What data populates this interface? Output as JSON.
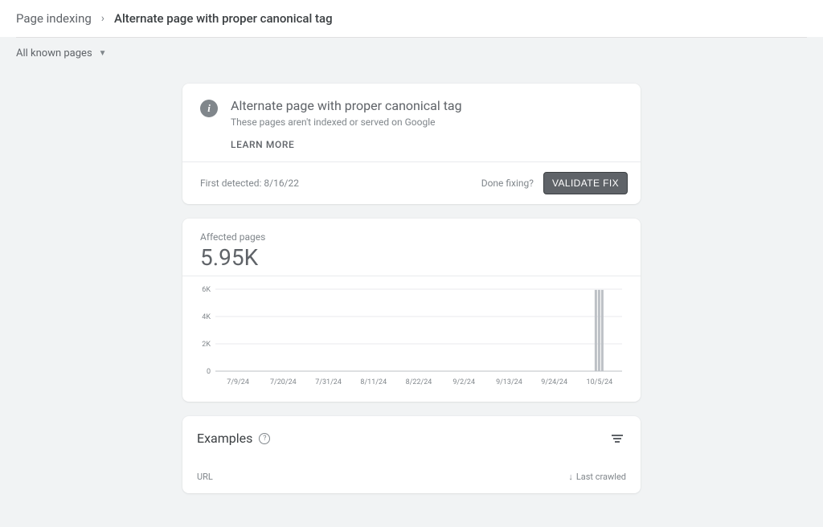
{
  "breadcrumb": {
    "parent": "Page indexing",
    "current": "Alternate page with proper canonical tag"
  },
  "filter": {
    "label": "All known pages"
  },
  "issue": {
    "title": "Alternate page with proper canonical tag",
    "subtitle": "These pages aren't indexed or served on Google",
    "learn_more": "LEARN MORE"
  },
  "validation": {
    "first_detected_label": "First detected:",
    "first_detected_date": "8/16/22",
    "done_fixing": "Done fixing?",
    "validate_button": "VALIDATE FIX"
  },
  "affected": {
    "label": "Affected pages",
    "value": "5.95K"
  },
  "chart_data": {
    "type": "bar",
    "categories": [
      "7/9/24",
      "7/20/24",
      "7/31/24",
      "8/11/24",
      "8/22/24",
      "9/2/24",
      "9/13/24",
      "9/24/24",
      "10/5/24"
    ],
    "values": [
      0,
      0,
      0,
      0,
      0,
      0,
      0,
      0,
      5950
    ],
    "ylabel": "",
    "xlabel": "",
    "ylim": [
      0,
      6000
    ],
    "y_ticks": [
      0,
      2000,
      4000,
      6000
    ],
    "y_tick_labels": [
      "0",
      "2K",
      "4K",
      "6K"
    ]
  },
  "examples": {
    "title": "Examples",
    "col_url": "URL",
    "col_sort": "Last crawled"
  }
}
